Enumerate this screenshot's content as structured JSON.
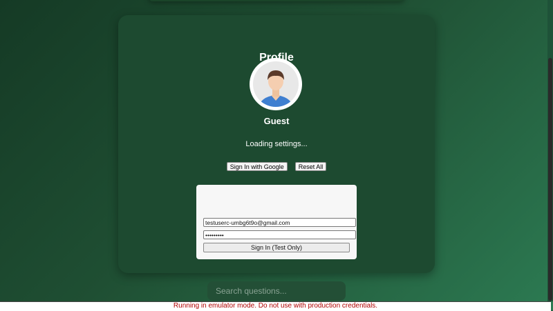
{
  "profile": {
    "title": "Profile",
    "username": "Guest",
    "status_text": "Loading settings...",
    "avatar_icon": "user-avatar-icon"
  },
  "actions": {
    "sign_in_google_label": "Sign In with Google",
    "reset_all_label": "Reset All"
  },
  "test_login": {
    "title": "",
    "email_value": "testuserc-umbg6t9o@gmail.com",
    "password_value": "password1",
    "submit_label": "Sign In (Test Only)"
  },
  "search": {
    "placeholder": "Search questions..."
  },
  "banner": {
    "text": "Running in emulator mode. Do not use with production credentials."
  },
  "colors": {
    "background_start": "#153a25",
    "background_end": "#2c7a52",
    "card": "#1d4a30",
    "banner_text": "#b00000"
  }
}
